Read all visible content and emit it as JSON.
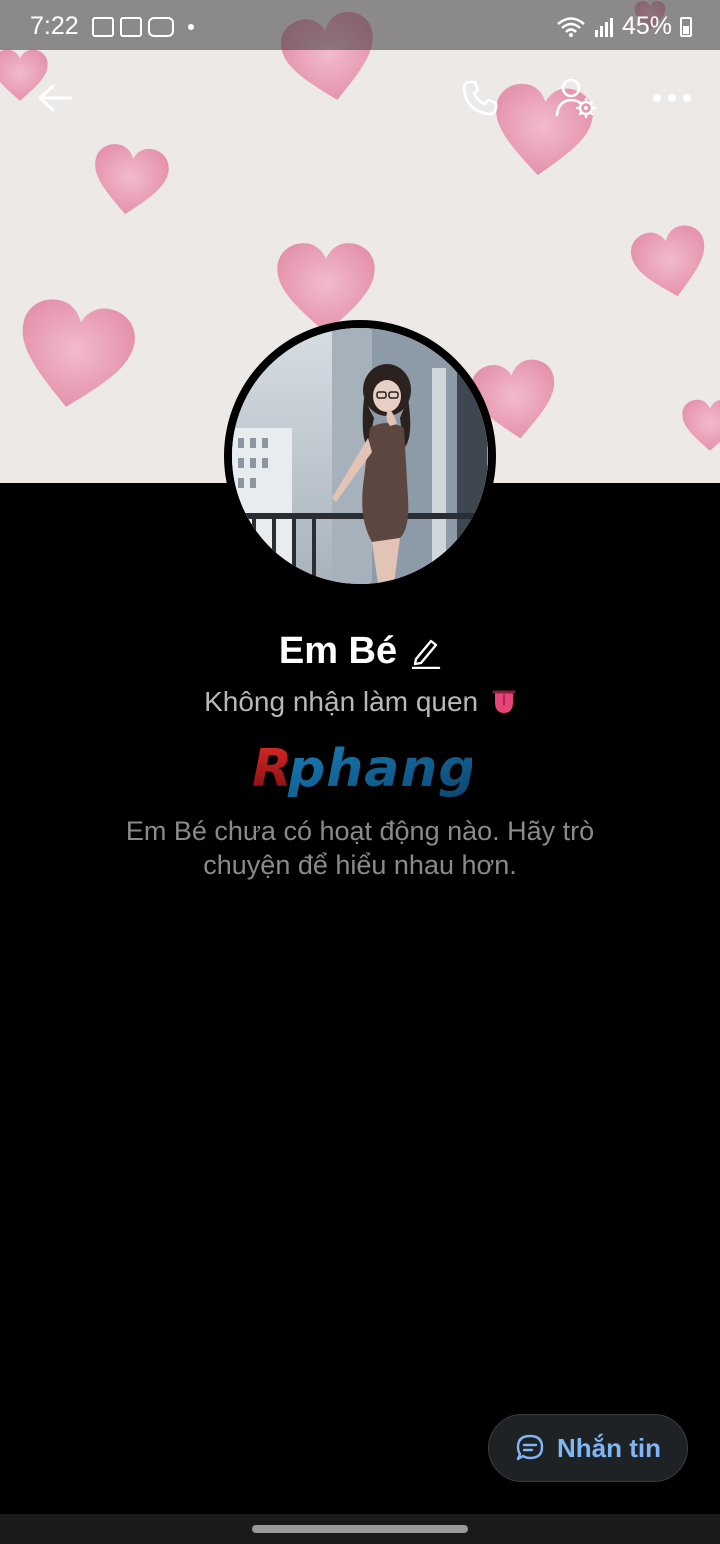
{
  "status_bar": {
    "time": "7:22",
    "battery": "45%",
    "notification_icons": [
      "gallery-icon",
      "linkedin-icon",
      "youtube-icon"
    ]
  },
  "top_bar": {
    "back_icon": "arrow-left-icon",
    "call_icon": "phone-icon",
    "settings_icon": "user-settings-icon",
    "more_icon": "more-horizontal-icon"
  },
  "profile": {
    "name": "Em Bé",
    "status": "Không nhận làm quen",
    "status_emoji_icon": "tongue-emoji-icon",
    "watermark_logo": "Rphang",
    "empty_activity": "Em Bé chưa có hoạt động nào. Hãy trò chuyện để hiểu nhau hơn."
  },
  "actions": {
    "message_label": "Nhắn tin"
  },
  "colors": {
    "background": "#000000",
    "accent": "#7fb6f5",
    "cover_hearts": "#e891ad"
  }
}
